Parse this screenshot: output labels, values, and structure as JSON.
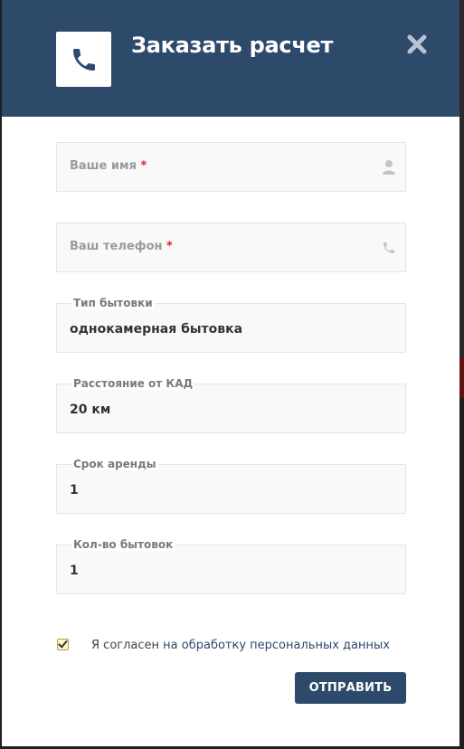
{
  "header": {
    "title": "Заказать расчет",
    "icon": "phone-icon",
    "close_icon": "close-icon"
  },
  "form": {
    "name": {
      "placeholder": "Ваше имя",
      "required_mark": "*",
      "icon": "user-icon"
    },
    "phone": {
      "placeholder": "Ваш телефон",
      "required_mark": "*",
      "icon": "phone-icon"
    },
    "cabin_type": {
      "label": "Тип бытовки",
      "value": "однокамерная бытовка"
    },
    "distance": {
      "label": "Расстояние от КАД",
      "value": "20 км"
    },
    "rent_term": {
      "label": "Срок аренды",
      "value": "1"
    },
    "quantity": {
      "label": "Кол-во бытовок",
      "value": "1"
    }
  },
  "consent": {
    "checked": true,
    "text": "Я согласен ",
    "link_text": "на обработку персональных данных"
  },
  "submit_label": "ОТПРАВИТЬ",
  "colors": {
    "header_bg": "#2d4a6b",
    "button_bg": "#2d4a6b",
    "required": "#d9262b"
  }
}
